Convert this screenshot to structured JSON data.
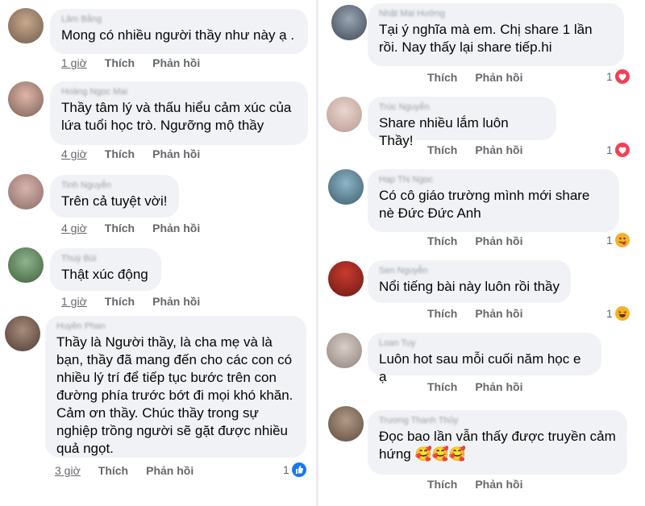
{
  "left": [
    {
      "author": "Lâm Bằng",
      "text": "Mong có nhiều người thầy như này ạ  .",
      "time": "1 giờ",
      "like": "Thích",
      "reply": "Phản hồi"
    },
    {
      "author": "Hoàng Ngọc Mai",
      "text": "Thầy tâm lý và thấu hiểu cảm xúc của lứa tuổi học trò. Ngưỡng mộ thầy",
      "time": "4 giờ",
      "like": "Thích",
      "reply": "Phản hồi"
    },
    {
      "author": "Tinh Nguyễn",
      "text": "Trên cả tuyệt vời!",
      "time": "4 giờ",
      "like": "Thích",
      "reply": "Phản hồi"
    },
    {
      "author": "Thuỳ Bùi",
      "text": "Thật xúc động",
      "time": "1 giờ",
      "like": "Thích",
      "reply": "Phản hồi"
    },
    {
      "author": "Huyền Phan",
      "text": "Thầy là Người thầy, là cha mẹ và là bạn, thầy đã mang đến cho các con có nhiều lý trí để tiếp tục bước trên con đường phía trước bớt đi mọi khó khăn. Cảm ơn thầy. Chúc thầy trong sự nghiệp trồng người sẽ gặt được nhiều quả ngọt.",
      "time": "3 giờ",
      "like": "Thích",
      "reply": "Phản hồi",
      "reaction_count": "1",
      "reaction": "like"
    }
  ],
  "right": [
    {
      "author": "Nhật Mai Hường",
      "text": "Tại ý nghĩa mà em. Chị share 1 lần rồi. Nay thấy lại share tiếp.hi",
      "like": "Thích",
      "reply": "Phản hồi",
      "reaction_count": "1",
      "reaction": "love"
    },
    {
      "author": "Trúc Nguyễn",
      "text": "Share nhiều lắm luôn Thầy!",
      "like": "Thích",
      "reply": "Phản hồi",
      "reaction_count": "1",
      "reaction": "love"
    },
    {
      "author": "Hạp Thị Ngọc",
      "text": "Có cô giáo trường mình mới share nè Đức Đức Anh",
      "like": "Thích",
      "reply": "Phản hồi",
      "reaction_count": "1",
      "reaction": "haha-tongue"
    },
    {
      "author": "Sen Nguyễn",
      "text": "Nổi tiếng bài này luôn rồi thầy",
      "like": "Thích",
      "reply": "Phản hồi",
      "reaction_count": "1",
      "reaction": "haha"
    },
    {
      "author": "Loan Tuy",
      "text": "Luôn hot sau mỗi cuối năm học e ạ",
      "like": "Thích",
      "reply": "Phản hồi"
    },
    {
      "author": "Trương Thanh Thủy",
      "text": "Đọc bao lần vẫn thấy được truyền cảm hứng 🥰🥰🥰",
      "like": "Thích",
      "reply": "Phản hồi"
    }
  ],
  "colors": {
    "bubble": "#f0f2f5",
    "meta": "#65676b",
    "like_blue": "#1877f2",
    "love_red": "#f33e58",
    "haha_yellow": "#f7b125"
  }
}
